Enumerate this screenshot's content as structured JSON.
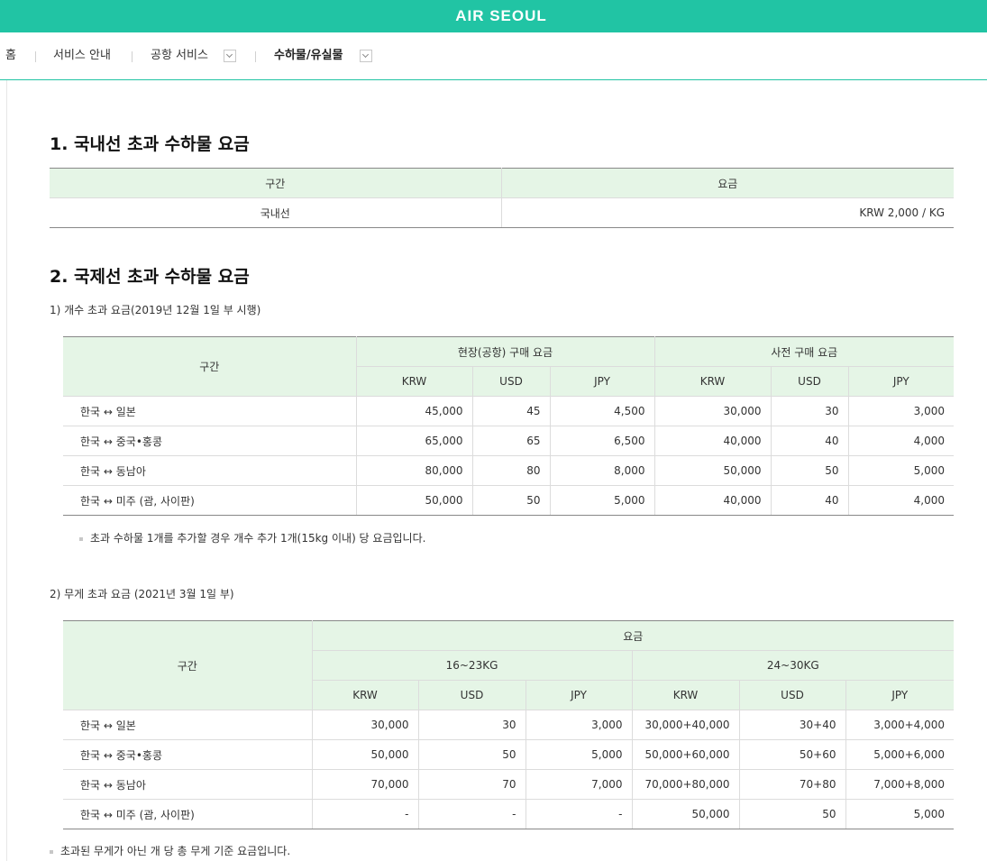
{
  "header": {
    "logo": "AIR SEOUL"
  },
  "breadcrumb": {
    "home": "홈",
    "service_info": "서비스 안내",
    "airport_service": "공항 서비스",
    "current": "수하물/유실물"
  },
  "domestic": {
    "title": "1. 국내선 초과 수하물 요금",
    "headers": [
      "구간",
      "요금"
    ],
    "rows": [
      [
        "국내선",
        "KRW 2,000 / KG"
      ]
    ]
  },
  "international": {
    "title": "2. 국제선 초과 수하물 요금",
    "piece": {
      "subtitle": "1) 개수 초과 요금(2019년 12월 1일 부 시행)",
      "route_header": "구간",
      "group_onsite": "현장(공항) 구매 요금",
      "group_advance": "사전 구매 요금",
      "currencies": [
        "KRW",
        "USD",
        "JPY",
        "KRW",
        "USD",
        "JPY"
      ],
      "rows": [
        [
          "한국 ↔ 일본",
          "45,000",
          "45",
          "4,500",
          "30,000",
          "30",
          "3,000"
        ],
        [
          "한국 ↔ 중국•홍콩",
          "65,000",
          "65",
          "6,500",
          "40,000",
          "40",
          "4,000"
        ],
        [
          "한국 ↔ 동남아",
          "80,000",
          "80",
          "8,000",
          "50,000",
          "50",
          "5,000"
        ],
        [
          "한국 ↔ 미주 (괌, 사이판)",
          "50,000",
          "50",
          "5,000",
          "40,000",
          "40",
          "4,000"
        ]
      ],
      "note": "초과 수하물 1개를 추가할 경우 개수 추가 1개(15kg 이내) 당 요금입니다."
    },
    "weight": {
      "subtitle": "2) 무게 초과 요금 (2021년 3월 1일 부)",
      "route_header": "구간",
      "fee_header": "요금",
      "band1": "16~23KG",
      "band2": "24~30KG",
      "currencies": [
        "KRW",
        "USD",
        "JPY",
        "KRW",
        "USD",
        "JPY"
      ],
      "rows": [
        [
          "한국 ↔ 일본",
          "30,000",
          "30",
          "3,000",
          "30,000+40,000",
          "30+40",
          "3,000+4,000"
        ],
        [
          "한국 ↔ 중국•홍콩",
          "50,000",
          "50",
          "5,000",
          "50,000+60,000",
          "50+60",
          "5,000+6,000"
        ],
        [
          "한국 ↔ 동남아",
          "70,000",
          "70",
          "7,000",
          "70,000+80,000",
          "70+80",
          "7,000+8,000"
        ],
        [
          "한국 ↔ 미주 (괌, 사이판)",
          "-",
          "-",
          "-",
          "50,000",
          "50",
          "5,000"
        ]
      ],
      "note": "초과된 무게가 아닌 개 당 총 무게 기준 요금입니다."
    }
  },
  "colors": {
    "brand": "#21c4a4",
    "table_header_bg": "#e5f5e6"
  }
}
